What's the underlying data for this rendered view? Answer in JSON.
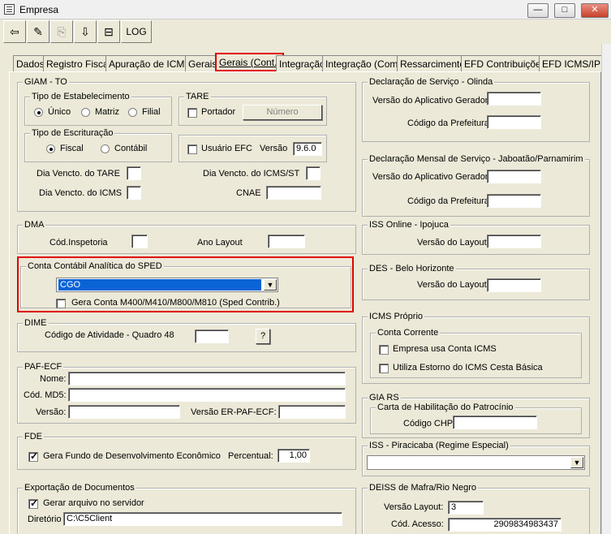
{
  "window": {
    "title": "Empresa",
    "min": "▭",
    "max": "▢",
    "close": "✕"
  },
  "toolbar": {
    "log_label": "LOG"
  },
  "tabs": [
    "Dados",
    "Registro Fiscal",
    "Apuração de ICMS",
    "Gerais",
    "Gerais (Cont.)",
    "Integração",
    "Integração (Com.)",
    "Ressarcimento",
    "EFD Contribuições",
    "EFD ICMS/IPI"
  ],
  "giam": {
    "title": "GIAM - TO",
    "tipo_estab": {
      "title": "Tipo de Estabelecimento",
      "opts": [
        "Único",
        "Matriz",
        "Filial"
      ]
    },
    "tare": {
      "title": "TARE",
      "portador": "Portador",
      "numero_btn": "Número"
    },
    "tipo_escr": {
      "title": "Tipo de Escrituração",
      "opts": [
        "Fiscal",
        "Contábil"
      ]
    },
    "efc": {
      "usuario": "Usuário EFC",
      "versao_label": "Versão",
      "versao_value": "9.6.0"
    },
    "dia_tare": "Dia Vencto. do TARE",
    "dia_icms_st": "Dia Vencto. do ICMS/ST",
    "dia_icms": "Dia Vencto. do ICMS",
    "cnae": "CNAE"
  },
  "dma": {
    "title": "DMA",
    "cod_insp": "Cód.Inspetoria",
    "ano_layout": "Ano Layout"
  },
  "sped": {
    "title": "Conta Contábil Analítica do SPED",
    "select_value": "CGO",
    "gera_conta": "Gera Conta M400/M410/M800/M810 (Sped Contrib.)"
  },
  "dime": {
    "title": "DIME",
    "cod_ativ": "Código de Atividade - Quadro 48",
    "btn": "?"
  },
  "paf": {
    "title": "PAF-ECF",
    "nome": "Nome:",
    "md5": "Cód. MD5:",
    "versao": "Versão:",
    "versao_er": "Versão ER-PAF-ECF:"
  },
  "fde": {
    "title": "FDE",
    "gera": "Gera Fundo de Desenvolvimento Econômico",
    "percentual": "Percentual:",
    "percentual_value": "1,00"
  },
  "export": {
    "title": "Exportação de Documentos",
    "gerar": "Gerar arquivo no servidor",
    "diretorio": "Diretório",
    "diretorio_value": "C:\\C5Client"
  },
  "decl_olinda": {
    "title": "Declaração de Serviço - Olinda",
    "versao": "Versão do Aplicativo Gerador",
    "codigo": "Código da Prefeitura"
  },
  "decl_jaboatao": {
    "title": "Declaração Mensal de Serviço - Jaboatão/Parnamirim",
    "versao": "Versão do Aplicativo Gerador",
    "codigo": "Código da Prefeitura"
  },
  "iss_ipojuca": {
    "title": "ISS Online - Ipojuca",
    "versao": "Versão do Layout"
  },
  "des_bh": {
    "title": "DES - Belo Horizonte",
    "versao": "Versão do Layout"
  },
  "icms_proprio": {
    "title": "ICMS Próprio",
    "conta": "Conta Corrente",
    "usa": "Empresa usa Conta ICMS",
    "estorno": "Utiliza Estorno do ICMS Cesta Básica"
  },
  "gia_rs": {
    "title": "GIA RS",
    "carta": "Carta de Habilitação do Patrocínio",
    "codigo": "Código CHP"
  },
  "iss_piracicaba": {
    "title": "ISS - Piracicaba (Regime Especial)"
  },
  "deiss": {
    "title": "DEISS de Mafra/Rio Negro",
    "versao": "Versão Layout:",
    "versao_value": "3",
    "cod": "Cód. Acesso:",
    "cod_value": "2909834983437"
  }
}
